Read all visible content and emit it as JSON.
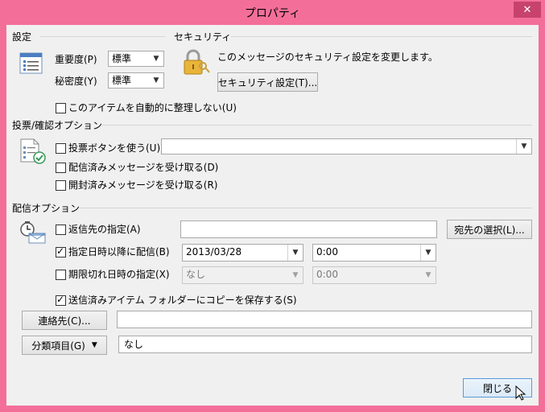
{
  "window": {
    "title": "プロパティ",
    "close_glyph": "✕"
  },
  "settings": {
    "label": "設定",
    "importance_label": "重要度(P)",
    "importance_value": "標準",
    "sensitivity_label": "秘密度(Y)",
    "sensitivity_value": "標準",
    "autoarchive_label": "このアイテムを自動的に整理しない(U)",
    "autoarchive_checked": false
  },
  "security": {
    "label": "セキュリティ",
    "description": "このメッセージのセキュリティ設定を変更します。",
    "button_label": "セキュリティ設定(T)..."
  },
  "voting": {
    "label": "投票/確認オプション",
    "voting_buttons_label": "投票ボタンを使う(U)",
    "voting_buttons_checked": false,
    "voting_value": "",
    "delivery_receipt_label": "配信済みメッセージを受け取る(D)",
    "delivery_receipt_checked": false,
    "read_receipt_label": "開封済みメッセージを受け取る(R)",
    "read_receipt_checked": false
  },
  "delivery": {
    "label": "配信オプション",
    "reply_to_label": "返信先の指定(A)",
    "reply_to_checked": false,
    "reply_to_value": "",
    "select_names_label": "宛先の選択(L)...",
    "delay_label": "指定日時以降に配信(B)",
    "delay_checked": true,
    "delay_date": "2013/03/28",
    "delay_time": "0:00",
    "expire_label": "期限切れ日時の指定(X)",
    "expire_checked": false,
    "expire_date": "なし",
    "expire_time": "0:00",
    "save_copy_label": "送信済みアイテム フォルダーにコピーを保存する(S)",
    "save_copy_checked": true
  },
  "contacts": {
    "button_label": "連絡先(C)...",
    "value": ""
  },
  "categories": {
    "button_label": "分類項目(G)",
    "value": "なし"
  },
  "footer": {
    "close_label": "閉じる"
  },
  "colors": {
    "frame": "#f36f9a",
    "close_button": "#c7436c",
    "dialog_bg": "#f0f0f0",
    "primary_border": "#5b9bd5"
  }
}
